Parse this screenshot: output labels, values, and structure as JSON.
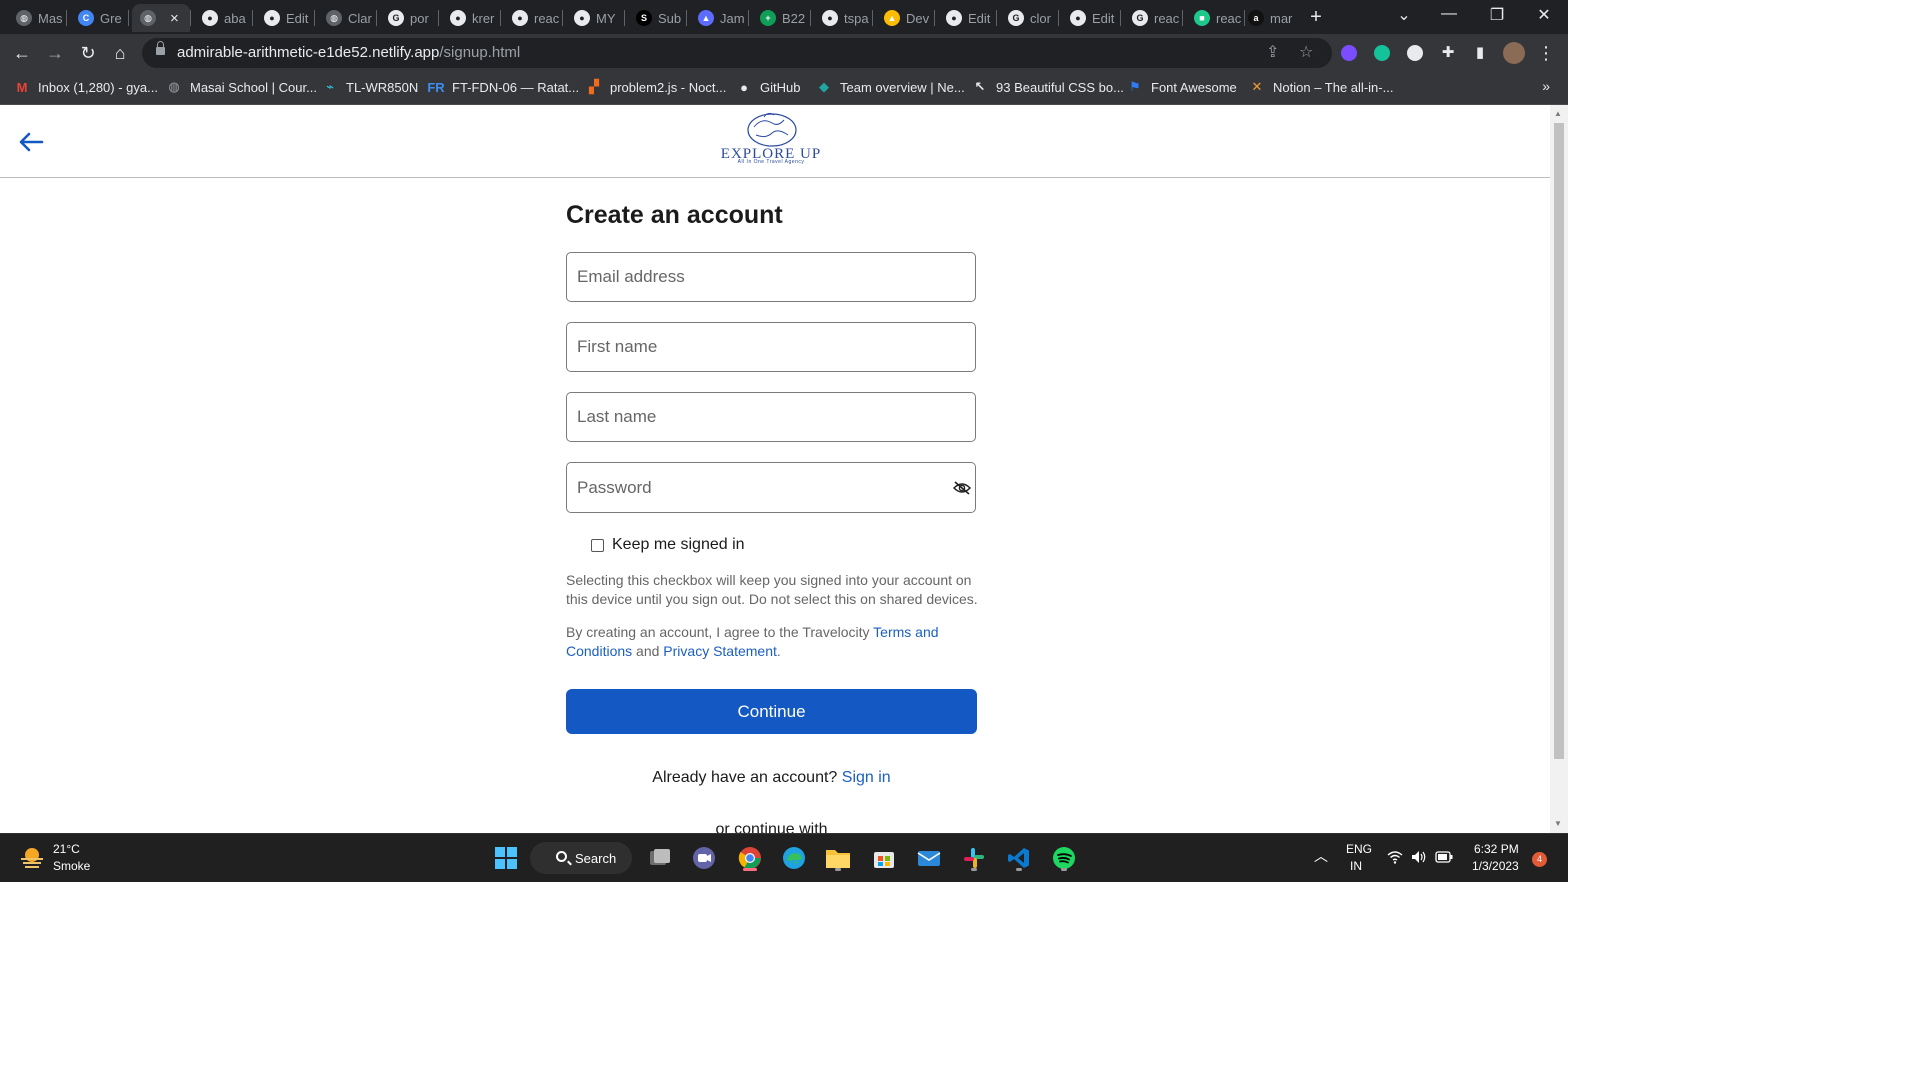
{
  "browser": {
    "tabs": [
      {
        "label": "Mas",
        "icon": "globe-icon",
        "color": "#5f6368"
      },
      {
        "label": "Gre",
        "icon": "grammarly-icon",
        "color": "#4285f4"
      },
      {
        "label": "",
        "icon": "globe-icon",
        "color": "#5f6368",
        "active": true
      },
      {
        "label": "aba",
        "icon": "github-icon",
        "color": "#e8eaed"
      },
      {
        "label": "Edit",
        "icon": "github-icon",
        "color": "#e8eaed"
      },
      {
        "label": "Clar",
        "icon": "globe-icon",
        "color": "#5f6368"
      },
      {
        "label": "por",
        "icon": "google-icon",
        "color": "#e8eaed"
      },
      {
        "label": "krer",
        "icon": "github-icon",
        "color": "#e8eaed"
      },
      {
        "label": "reac",
        "icon": "github-icon",
        "color": "#e8eaed"
      },
      {
        "label": "MY",
        "icon": "github-icon",
        "color": "#e8eaed"
      },
      {
        "label": "Sub",
        "icon": "sns-icon",
        "color": "#000000"
      },
      {
        "label": "Jam",
        "icon": "jam-icon",
        "color": "#5b6cff"
      },
      {
        "label": "B22",
        "icon": "sheets-plus-icon",
        "color": "#0f9d58"
      },
      {
        "label": "tspa",
        "icon": "github-icon",
        "color": "#e8eaed"
      },
      {
        "label": "Dev",
        "icon": "drive-icon",
        "color": "#fbbc04"
      },
      {
        "label": "Edit",
        "icon": "github-icon",
        "color": "#e8eaed"
      },
      {
        "label": "clor",
        "icon": "google-icon",
        "color": "#e8eaed"
      },
      {
        "label": "Edit",
        "icon": "github-icon",
        "color": "#e8eaed"
      },
      {
        "label": "reac",
        "icon": "google-icon",
        "color": "#e8eaed"
      },
      {
        "label": "reac",
        "icon": "green-app-icon",
        "color": "#1ec78a"
      },
      {
        "label": "mar",
        "icon": "ayo-icon",
        "color": "#111111"
      }
    ],
    "url_host": "admirable-arithmetic-e1de52.netlify.app",
    "url_path": "/signup.html",
    "bookmarks": [
      {
        "label": "Inbox (1,280) - gya...",
        "icon": "gmail-icon",
        "color": "#ea4335"
      },
      {
        "label": "Masai School | Cour...",
        "icon": "globe-icon",
        "color": "#9aa0a6"
      },
      {
        "label": "TL-WR850N",
        "icon": "tplink-icon",
        "color": "#2ec6e0"
      },
      {
        "label": "FT-FDN-06 — Ratat...",
        "icon": "fr-icon",
        "color": "#3d8ef0"
      },
      {
        "label": "problem2.js - Noct...",
        "icon": "noctest-icon",
        "color": "#f26b1d"
      },
      {
        "label": "GitHub",
        "icon": "github-icon",
        "color": "#e8eaed"
      },
      {
        "label": "Team overview | Ne...",
        "icon": "netlify-icon",
        "color": "#20a6a3"
      },
      {
        "label": "93 Beautiful CSS bo...",
        "icon": "cursor-icon",
        "color": "#e8eaed"
      },
      {
        "label": "Font Awesome",
        "icon": "flag-icon",
        "color": "#2f7cf6"
      },
      {
        "label": "Notion – The all-in-...",
        "icon": "tools-icon",
        "color": "#f0a030"
      }
    ],
    "bookmarks_more": "»"
  },
  "page": {
    "logo_text": "EXPLORE UP",
    "logo_tagline": "All In One Travel Agency",
    "title": "Create an account",
    "fields": {
      "email_placeholder": "Email address",
      "first_name_placeholder": "First name",
      "last_name_placeholder": "Last name",
      "password_placeholder": "Password"
    },
    "keep_signed_in": "Keep me signed in",
    "helper_text": "Selecting this checkbox will keep you signed into your account on this device until you sign out. Do not select this on shared devices.",
    "terms_prefix": "By creating an account, I agree to the Travelocity",
    "terms_link": "Terms and Conditions",
    "terms_and": "and",
    "privacy_link": "Privacy Statement",
    "terms_suffix": ".",
    "continue_label": "Continue",
    "have_account": "Already have an account?",
    "sign_in": "Sign in",
    "or_continue": "or continue with"
  },
  "taskbar": {
    "temperature": "21°C",
    "condition": "Smoke",
    "search_label": "Search",
    "lang_top": "ENG",
    "lang_bottom": "IN",
    "time": "6:32 PM",
    "date": "1/3/2023",
    "notifications": "4"
  }
}
